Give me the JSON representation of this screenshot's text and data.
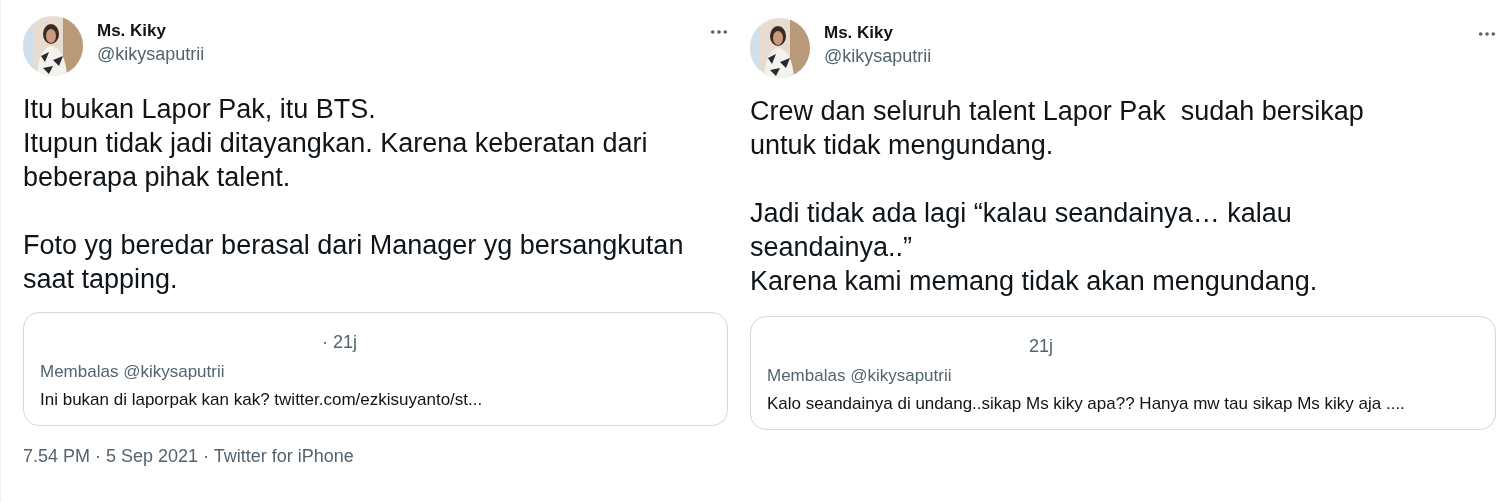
{
  "tweets": [
    {
      "author": {
        "name": "Ms. Kiky",
        "handle": "@kikysaputrii"
      },
      "body": [
        [
          "Itu bukan Lapor Pak, itu BTS.",
          "Itupun tidak jadi ditayangkan. Karena keberatan dari",
          "beberapa pihak talent."
        ],
        [
          "Foto yg beredar berasal dari Manager yg bersangkutan",
          "saat tapping."
        ]
      ],
      "reply": {
        "time": "· 21j",
        "replying_to": "Membalas @kikysaputrii",
        "text": "Ini bukan di laporpak kan kak? twitter.com/ezkisuyanto/st..."
      },
      "footer": "7.54 PM · 5 Sep 2021 · Twitter for iPhone"
    },
    {
      "author": {
        "name": "Ms. Kiky",
        "handle": "@kikysaputrii"
      },
      "body": [
        [
          "Crew dan seluruh talent Lapor Pak  sudah bersikap",
          "untuk tidak mengundang."
        ],
        [
          "Jadi tidak ada lagi “kalau seandainya… kalau",
          "seandainya..”",
          "Karena kami memang tidak akan mengundang."
        ]
      ],
      "reply": {
        "time": "21j",
        "replying_to": "Membalas @kikysaputrii",
        "text": "Kalo seandainya di undang..sikap Ms kiky apa?? Hanya mw tau sikap Ms kiky aja ...."
      }
    }
  ]
}
